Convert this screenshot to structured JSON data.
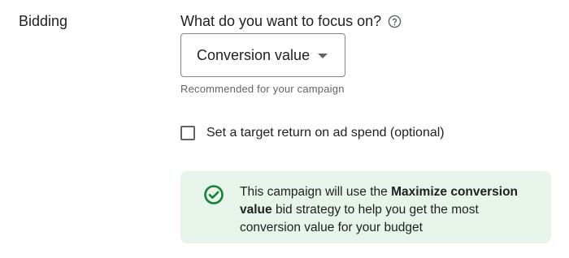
{
  "section": {
    "label": "Bidding"
  },
  "focus": {
    "question": "What do you want to focus on?",
    "help_icon": "help-circle-icon",
    "selected": "Conversion value",
    "hint": "Recommended for your campaign"
  },
  "target_roas": {
    "checked": false,
    "label": "Set a target return on ad spend (optional)"
  },
  "info": {
    "icon": "check-circle-icon",
    "text_before": "This campaign will use the ",
    "strategy_bold": "Maximize conversion value",
    "text_after": " bid strategy to help you get the most conversion value for your budget"
  },
  "colors": {
    "info_background": "#e6f4ea",
    "success_green": "#188038",
    "border": "#80868b"
  }
}
